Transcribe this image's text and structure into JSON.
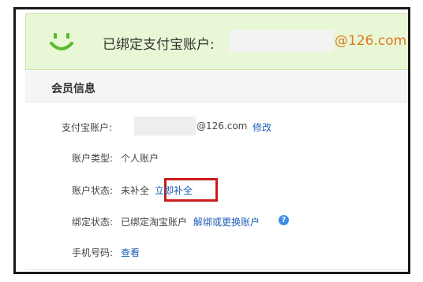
{
  "banner": {
    "label": "已绑定支付宝账户:",
    "email": "@126.com"
  },
  "section": {
    "title": "会员信息"
  },
  "rows": {
    "alipay_account": {
      "label": "支付宝账户:",
      "email": "@126.com",
      "action": "修改"
    },
    "account_type": {
      "label": "账户类型:",
      "value": "个人账户"
    },
    "account_status": {
      "label": "账户状态:",
      "value": "未补全",
      "action": "立即补全"
    },
    "binding_status": {
      "label": "绑定状态:",
      "value": "已绑定淘宝账户",
      "action": "解绑或更换账户",
      "help": "?"
    },
    "phone": {
      "label": "手机号码:",
      "action": "查看"
    }
  },
  "colors": {
    "banner_bg": "#e8f7d5",
    "smile": "#5bb82f",
    "link": "#1f5fb5",
    "highlight": "#c91c1c",
    "email_orange": "#e07a1f"
  },
  "icons": {
    "banner": "smile-icon",
    "help": "question-circle-icon"
  }
}
